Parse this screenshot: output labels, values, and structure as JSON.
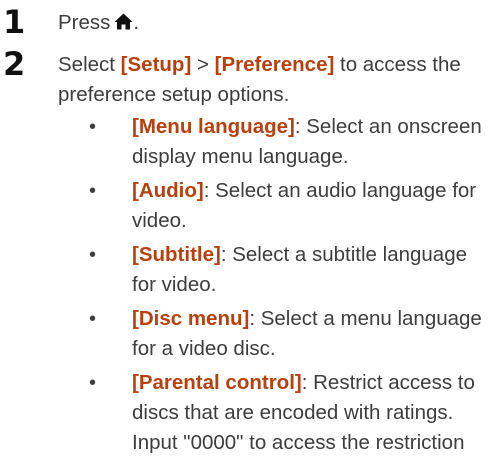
{
  "steps": [
    {
      "number": "1",
      "text": "Press",
      "icon": "home-icon",
      "after_icon": "."
    },
    {
      "number": "2",
      "pre": "Select ",
      "key1": "[Setup]",
      "mid": " > ",
      "key2": "[Preference]",
      "rest": " to access the preference setup options."
    }
  ],
  "bullets": [
    {
      "key": "[Menu language]",
      "text": ": Select an onscreen display menu language."
    },
    {
      "key": "[Audio]",
      "text": ": Select an audio language for video."
    },
    {
      "key": "[Subtitle]",
      "text": ": Select a subtitle language for video."
    },
    {
      "key": "[Disc menu]",
      "text": ": Select a menu language for a video disc."
    },
    {
      "key": "[Parental control]",
      "text": ": Restrict access to discs that are encoded with ratings. Input \"0000\" to access the restriction"
    }
  ],
  "colors": {
    "key": "#b7410e",
    "text": "#3d3d3d",
    "number": "#111111"
  }
}
